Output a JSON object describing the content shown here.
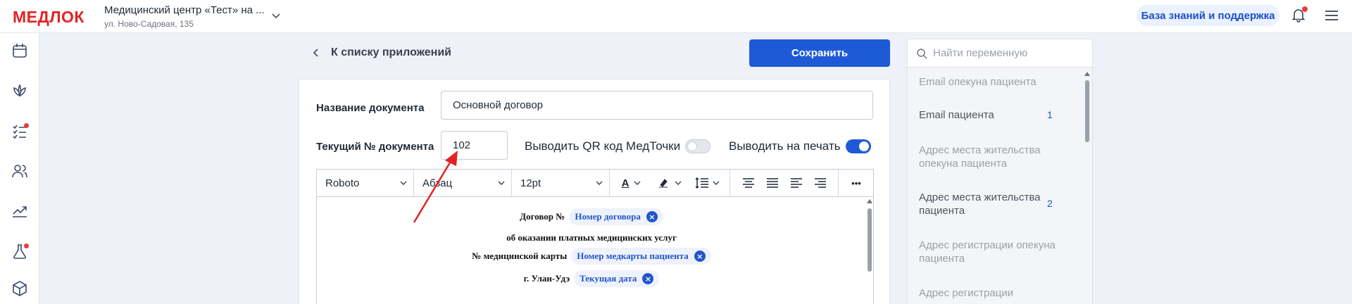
{
  "header": {
    "logo": "МЕДЛОК",
    "clinic_name": "Медицинский центр «Тест» на ...",
    "clinic_address": "ул. Ново-Садовая, 135",
    "kb_button": "База знаний и поддержка"
  },
  "sidebar": {
    "items": [
      {
        "icon": "calendar-icon"
      },
      {
        "icon": "lotus-icon"
      },
      {
        "icon": "checklist-icon",
        "badge": true
      },
      {
        "icon": "users-icon"
      },
      {
        "icon": "chart-icon"
      },
      {
        "icon": "flask-icon",
        "badge": true
      },
      {
        "icon": "box-icon"
      }
    ]
  },
  "nav": {
    "back_label": "К списку приложений",
    "save_label": "Сохранить"
  },
  "form": {
    "doc_name_label": "Название документа",
    "doc_name_value": "Основной договор",
    "doc_number_label": "Текущий № документа",
    "doc_number_value": "102",
    "qr_label": "Выводить QR код МедТочки",
    "qr_enabled": false,
    "print_label": "Выводить на печать",
    "print_enabled": true
  },
  "toolbar": {
    "font": "Roboto",
    "paragraph": "Абзац",
    "size": "12pt",
    "text_color_glyph": "A",
    "more_glyph": "•••"
  },
  "editor": {
    "line1_text": "Договор №",
    "line1_chip": "Номер договора",
    "line2_text": "об оказании платных медицинских услуг",
    "line3_text": "№ медицинской карты",
    "line3_chip": "Номер медкарты пациента",
    "line4_text": "г. Улан-Удэ",
    "line4_chip": "Текущая дата",
    "chip_close": "×"
  },
  "variables": {
    "search_placeholder": "Найти переменную",
    "items": [
      {
        "label": "Email опекуна пациента",
        "count": null,
        "enabled": false
      },
      {
        "label": "Email пациента",
        "count": "1",
        "enabled": true
      },
      {
        "label": "Адрес места жительства опекуна пациента",
        "count": null,
        "enabled": false
      },
      {
        "label": "Адрес места жительства пациента",
        "count": "2",
        "enabled": true
      },
      {
        "label": "Адрес регистрации опекуна пациента",
        "count": null,
        "enabled": false
      },
      {
        "label": "Адрес регистрации",
        "count": null,
        "enabled": false
      }
    ]
  },
  "colors": {
    "brand": "#e02424",
    "primary": "#1f5ad6",
    "chip_text": "#2156c9",
    "annotation_arrow": "#e02424"
  }
}
